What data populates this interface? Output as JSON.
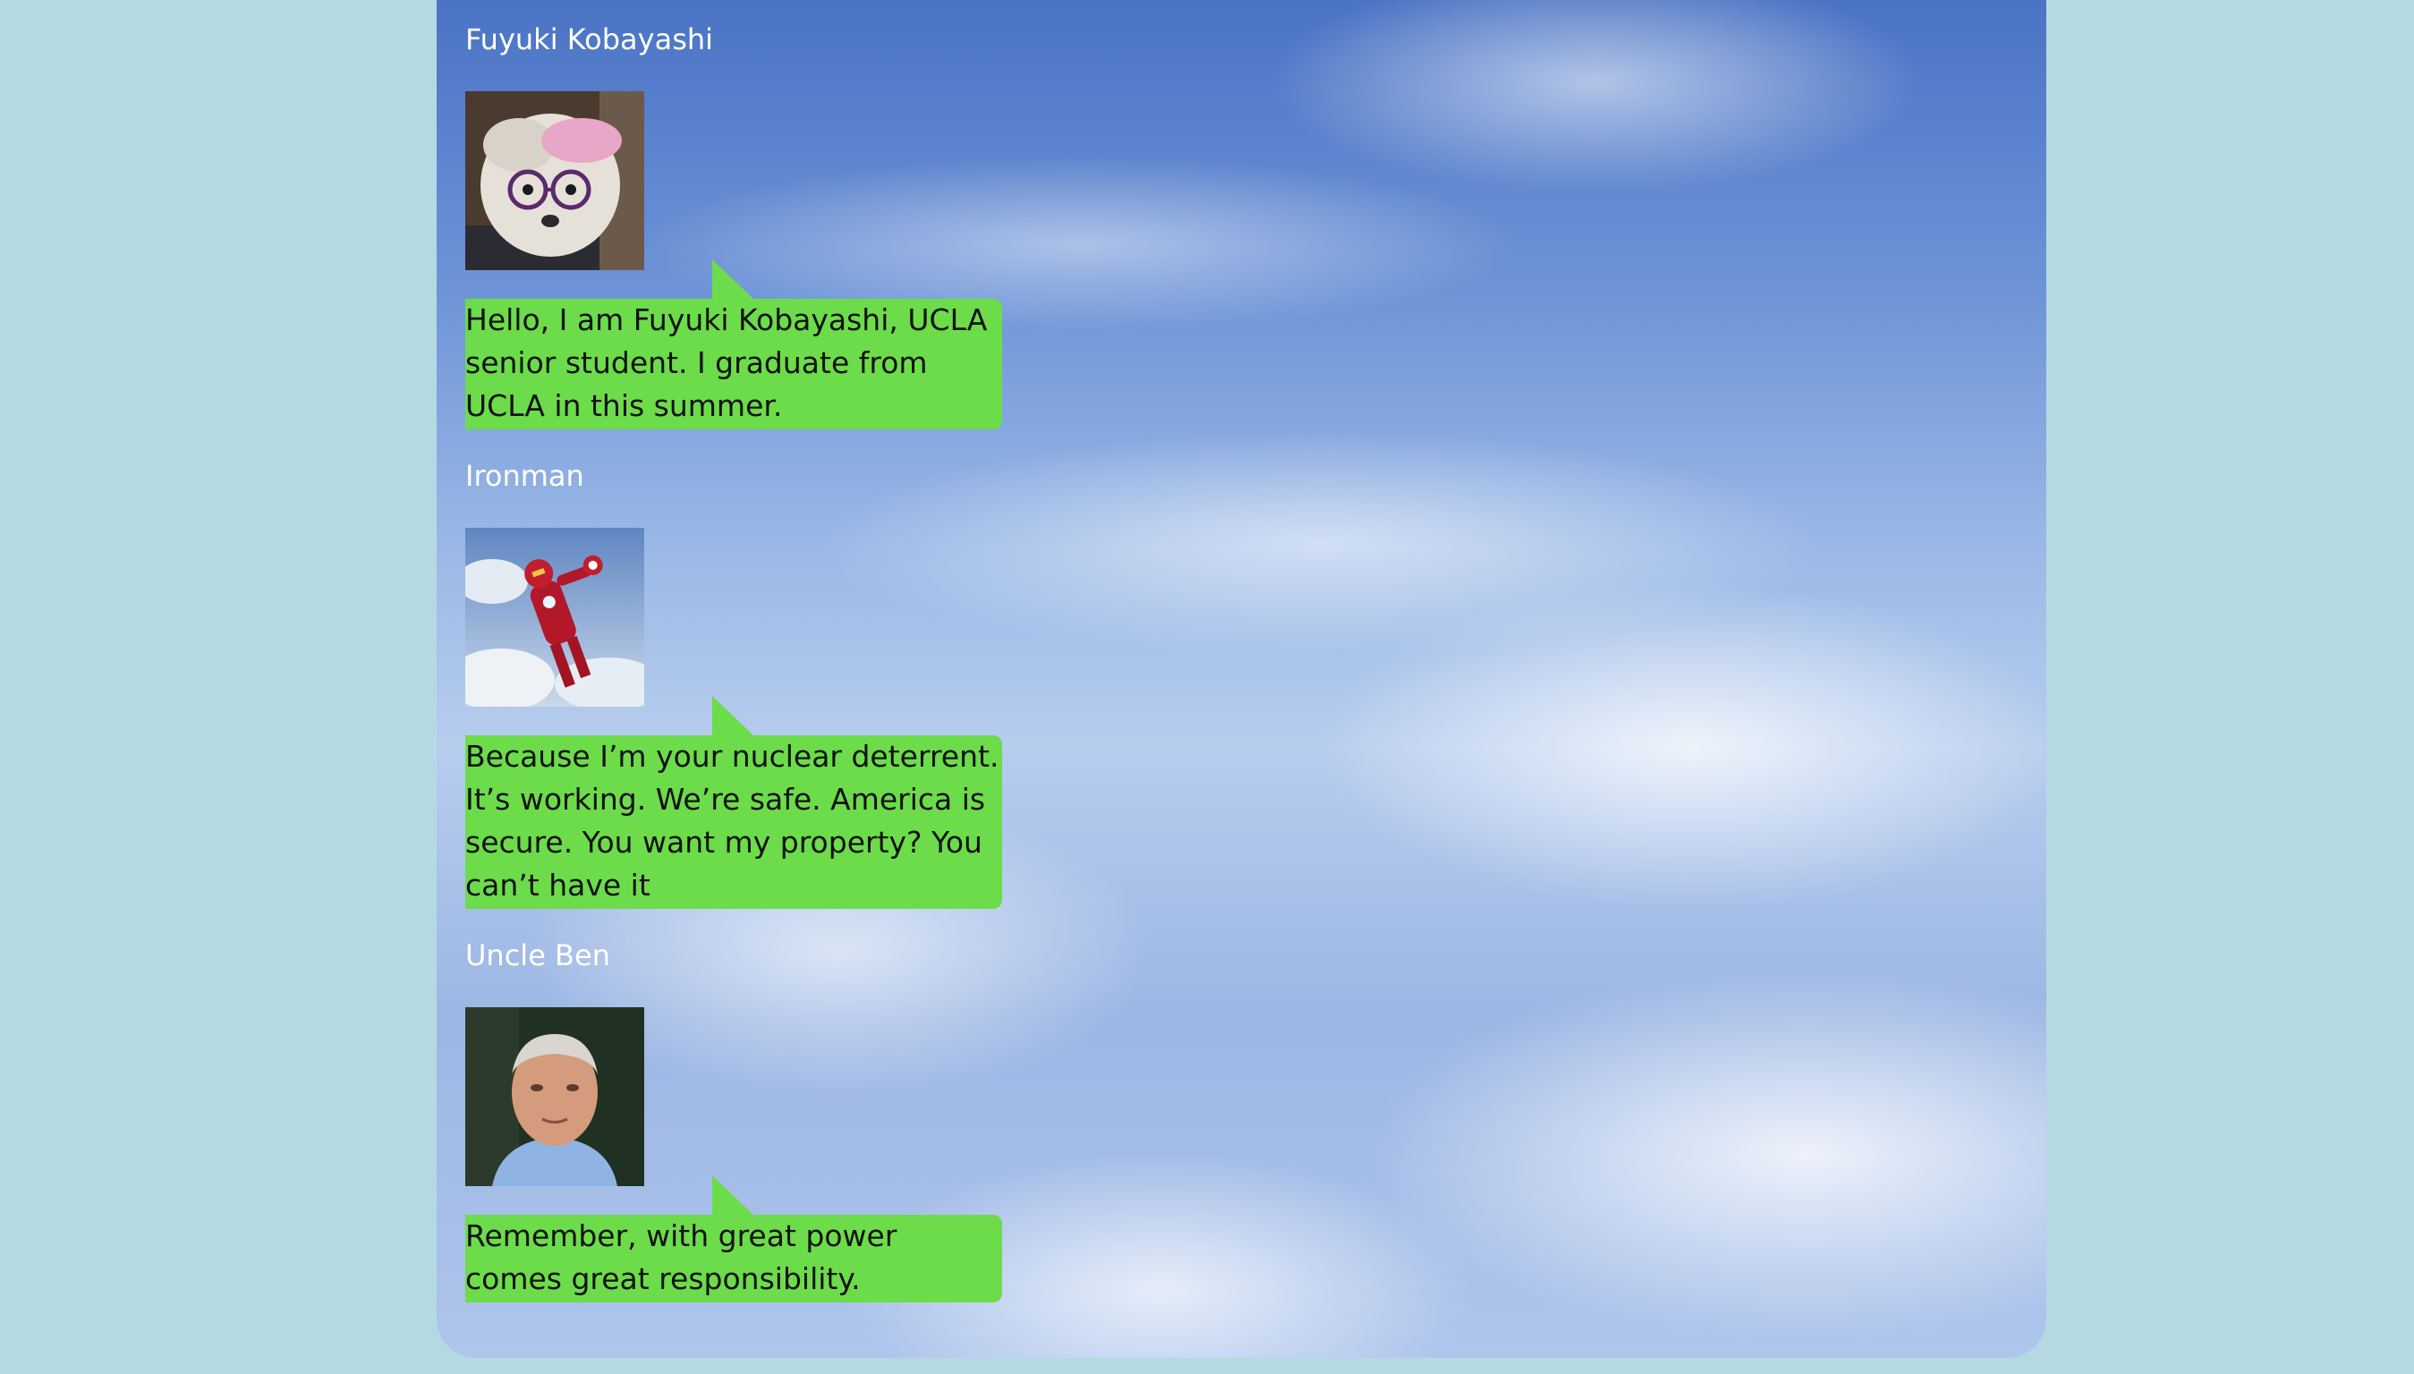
{
  "messages": [
    {
      "sender": "Fuyuki Kobayashi",
      "avatar": "dog-with-glasses-avatar",
      "text": "Hello, I am Fuyuki Kobayashi, UCLA senior student. I graduate from UCLA in this summer."
    },
    {
      "sender": "Ironman",
      "avatar": "ironman-flying-avatar",
      "text": "Because I’m your nuclear deterrent. It’s working. We’re safe. America is secure. You want my property? You can’t have it"
    },
    {
      "sender": "Uncle Ben",
      "avatar": "uncle-ben-portrait-avatar",
      "text": "Remember, with great power comes great responsibility."
    }
  ],
  "colors": {
    "page_background": "#b5d9e3",
    "bubble": "#6cdc4a",
    "sender_name": "#ffffff"
  }
}
